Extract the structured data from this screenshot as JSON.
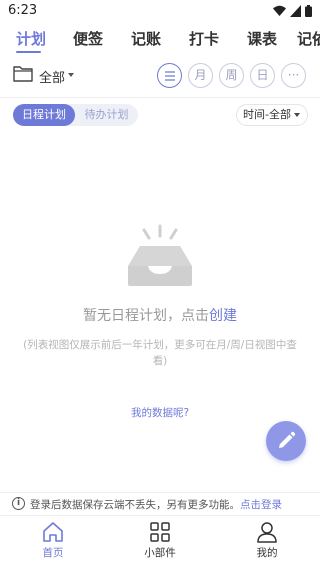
{
  "status": {
    "time": "6:23"
  },
  "tabs": [
    {
      "label": "计划",
      "active": true
    },
    {
      "label": "便签",
      "active": false
    },
    {
      "label": "记账",
      "active": false
    },
    {
      "label": "打卡",
      "active": false
    },
    {
      "label": "课表",
      "active": false
    },
    {
      "label": "记依",
      "active": false
    }
  ],
  "toolbar": {
    "folder_label": "全部",
    "view_buttons": [
      {
        "label": "☰",
        "icon": "list-view-icon",
        "active": true
      },
      {
        "label": "月",
        "active": false
      },
      {
        "label": "周",
        "active": false
      },
      {
        "label": "日",
        "active": false
      },
      {
        "label": "···",
        "icon": "more-icon",
        "active": false
      }
    ]
  },
  "segment": {
    "left": "日程计划",
    "right": "待办计划"
  },
  "time_filter": {
    "label": "时间-全部"
  },
  "empty_state": {
    "title_prefix": "暂无日程计划，点击",
    "title_link": "创建",
    "subtitle": "(列表视图仅展示前后一年计划，更多可在月/周/日视图中查看)",
    "data_link": "我的数据呢?"
  },
  "login_bar": {
    "text": "登录后数据保存云端不丢失，另有更多功能。",
    "link": "点击登录"
  },
  "bottom_nav": [
    {
      "label": "首页",
      "icon": "home-icon",
      "active": true
    },
    {
      "label": "小部件",
      "icon": "widgets-icon",
      "active": false
    },
    {
      "label": "我的",
      "icon": "profile-icon",
      "active": false
    }
  ],
  "colors": {
    "accent": "#6e7ad8",
    "fab": "#8f98e6",
    "muted": "#999999"
  }
}
